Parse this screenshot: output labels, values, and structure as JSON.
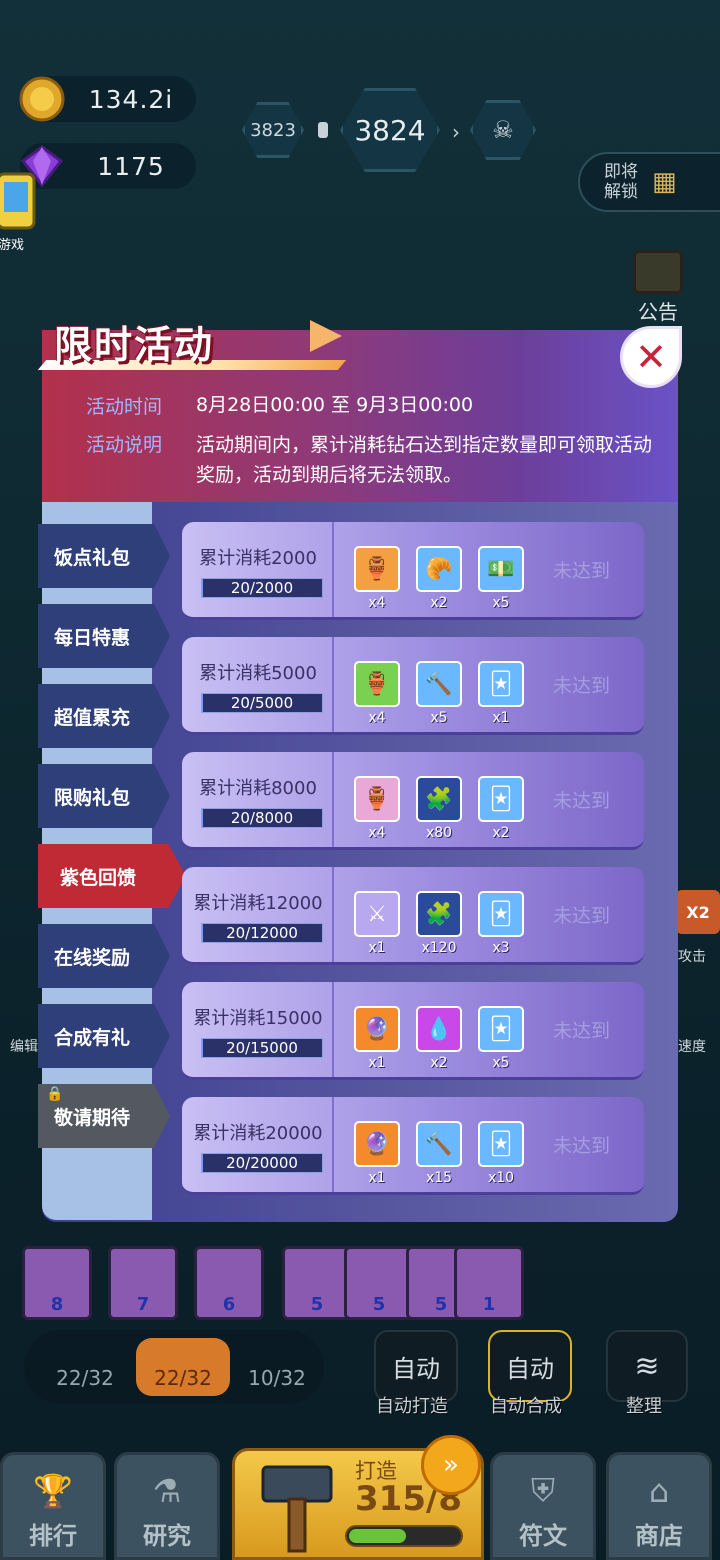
{
  "hud": {
    "coins": "134.2i",
    "gems": "1175",
    "level_prev": "3823",
    "level_current": "3824",
    "unlock_label": "即将\n解锁",
    "notice_label": "公告",
    "game_label": "游戏",
    "side_labels": {
      "attack": "攻击",
      "speed": "速度",
      "edit": "编辑",
      "x2": "X2"
    }
  },
  "modal": {
    "title": "限时活动",
    "time_label": "活动时间",
    "time_value": "8月28日00:00 至 9月3日00:00",
    "desc_label": "活动说明",
    "desc_value": "活动期间内，累计消耗钻石达到指定数量即可领取活动奖励，活动到期后将无法领取。",
    "close_icon": "close-icon"
  },
  "tabs": [
    {
      "label": "饭点礼包"
    },
    {
      "label": "每日特惠"
    },
    {
      "label": "超值累充"
    },
    {
      "label": "限购礼包"
    },
    {
      "label": "紫色回馈"
    },
    {
      "label": "在线奖励"
    },
    {
      "label": "合成有礼"
    },
    {
      "label": "敬请期待"
    }
  ],
  "rows": [
    {
      "requirement": "累计消耗2000",
      "progress": "20/2000",
      "progress_fraction": 0.01,
      "status": "未达到",
      "rewards": [
        {
          "icon": "chest-10-icon",
          "count": "x4"
        },
        {
          "icon": "croissant-icon",
          "count": "x2"
        },
        {
          "icon": "cash-icon",
          "count": "x5"
        }
      ]
    },
    {
      "requirement": "累计消耗5000",
      "progress": "20/5000",
      "progress_fraction": 0.004,
      "status": "未达到",
      "rewards": [
        {
          "icon": "chest-11-icon",
          "count": "x4"
        },
        {
          "icon": "hammer-icon",
          "count": "x5"
        },
        {
          "icon": "winged-card-icon",
          "count": "x1"
        }
      ]
    },
    {
      "requirement": "累计消耗8000",
      "progress": "20/8000",
      "progress_fraction": 0.0025,
      "status": "未达到",
      "rewards": [
        {
          "icon": "chest-12-icon",
          "count": "x4"
        },
        {
          "icon": "puzzle-icon",
          "count": "x80"
        },
        {
          "icon": "winged-card-icon",
          "count": "x2"
        }
      ]
    },
    {
      "requirement": "累计消耗12000",
      "progress": "20/12000",
      "progress_fraction": 0.0017,
      "status": "未达到",
      "rewards": [
        {
          "icon": "winged-sword-icon",
          "count": "x1"
        },
        {
          "icon": "puzzle-icon",
          "count": "x120"
        },
        {
          "icon": "winged-card-icon",
          "count": "x3"
        }
      ]
    },
    {
      "requirement": "累计消耗15000",
      "progress": "20/15000",
      "progress_fraction": 0.0013,
      "status": "未达到",
      "rewards": [
        {
          "icon": "gem-orb-icon",
          "count": "x1"
        },
        {
          "icon": "droplets-icon",
          "count": "x2"
        },
        {
          "icon": "winged-card-icon",
          "count": "x5"
        }
      ]
    },
    {
      "requirement": "累计消耗20000",
      "progress": "20/20000",
      "progress_fraction": 0.001,
      "status": "未达到",
      "rewards": [
        {
          "icon": "gem-orb-icon",
          "count": "x1"
        },
        {
          "icon": "hammer-icon",
          "count": "x15"
        },
        {
          "icon": "winged-card-icon",
          "count": "x10"
        }
      ]
    }
  ],
  "bottom": {
    "tools": [
      {
        "label": "22/32"
      },
      {
        "label": "22/32"
      },
      {
        "label": "10/32"
      }
    ],
    "auto_forge_btn": "自动",
    "auto_forge_label": "自动打造",
    "auto_merge_btn": "自动",
    "auto_merge_label": "自动合成",
    "sort_label": "整理",
    "slots": [
      "8",
      "7",
      "6",
      "5",
      "5",
      "5",
      "1"
    ],
    "nav": {
      "rank": "排行",
      "research": "研究",
      "rune": "符文",
      "shop": "商店"
    },
    "forge": {
      "label": "打造",
      "value": "315/8",
      "progress_fraction": 0.5
    }
  }
}
